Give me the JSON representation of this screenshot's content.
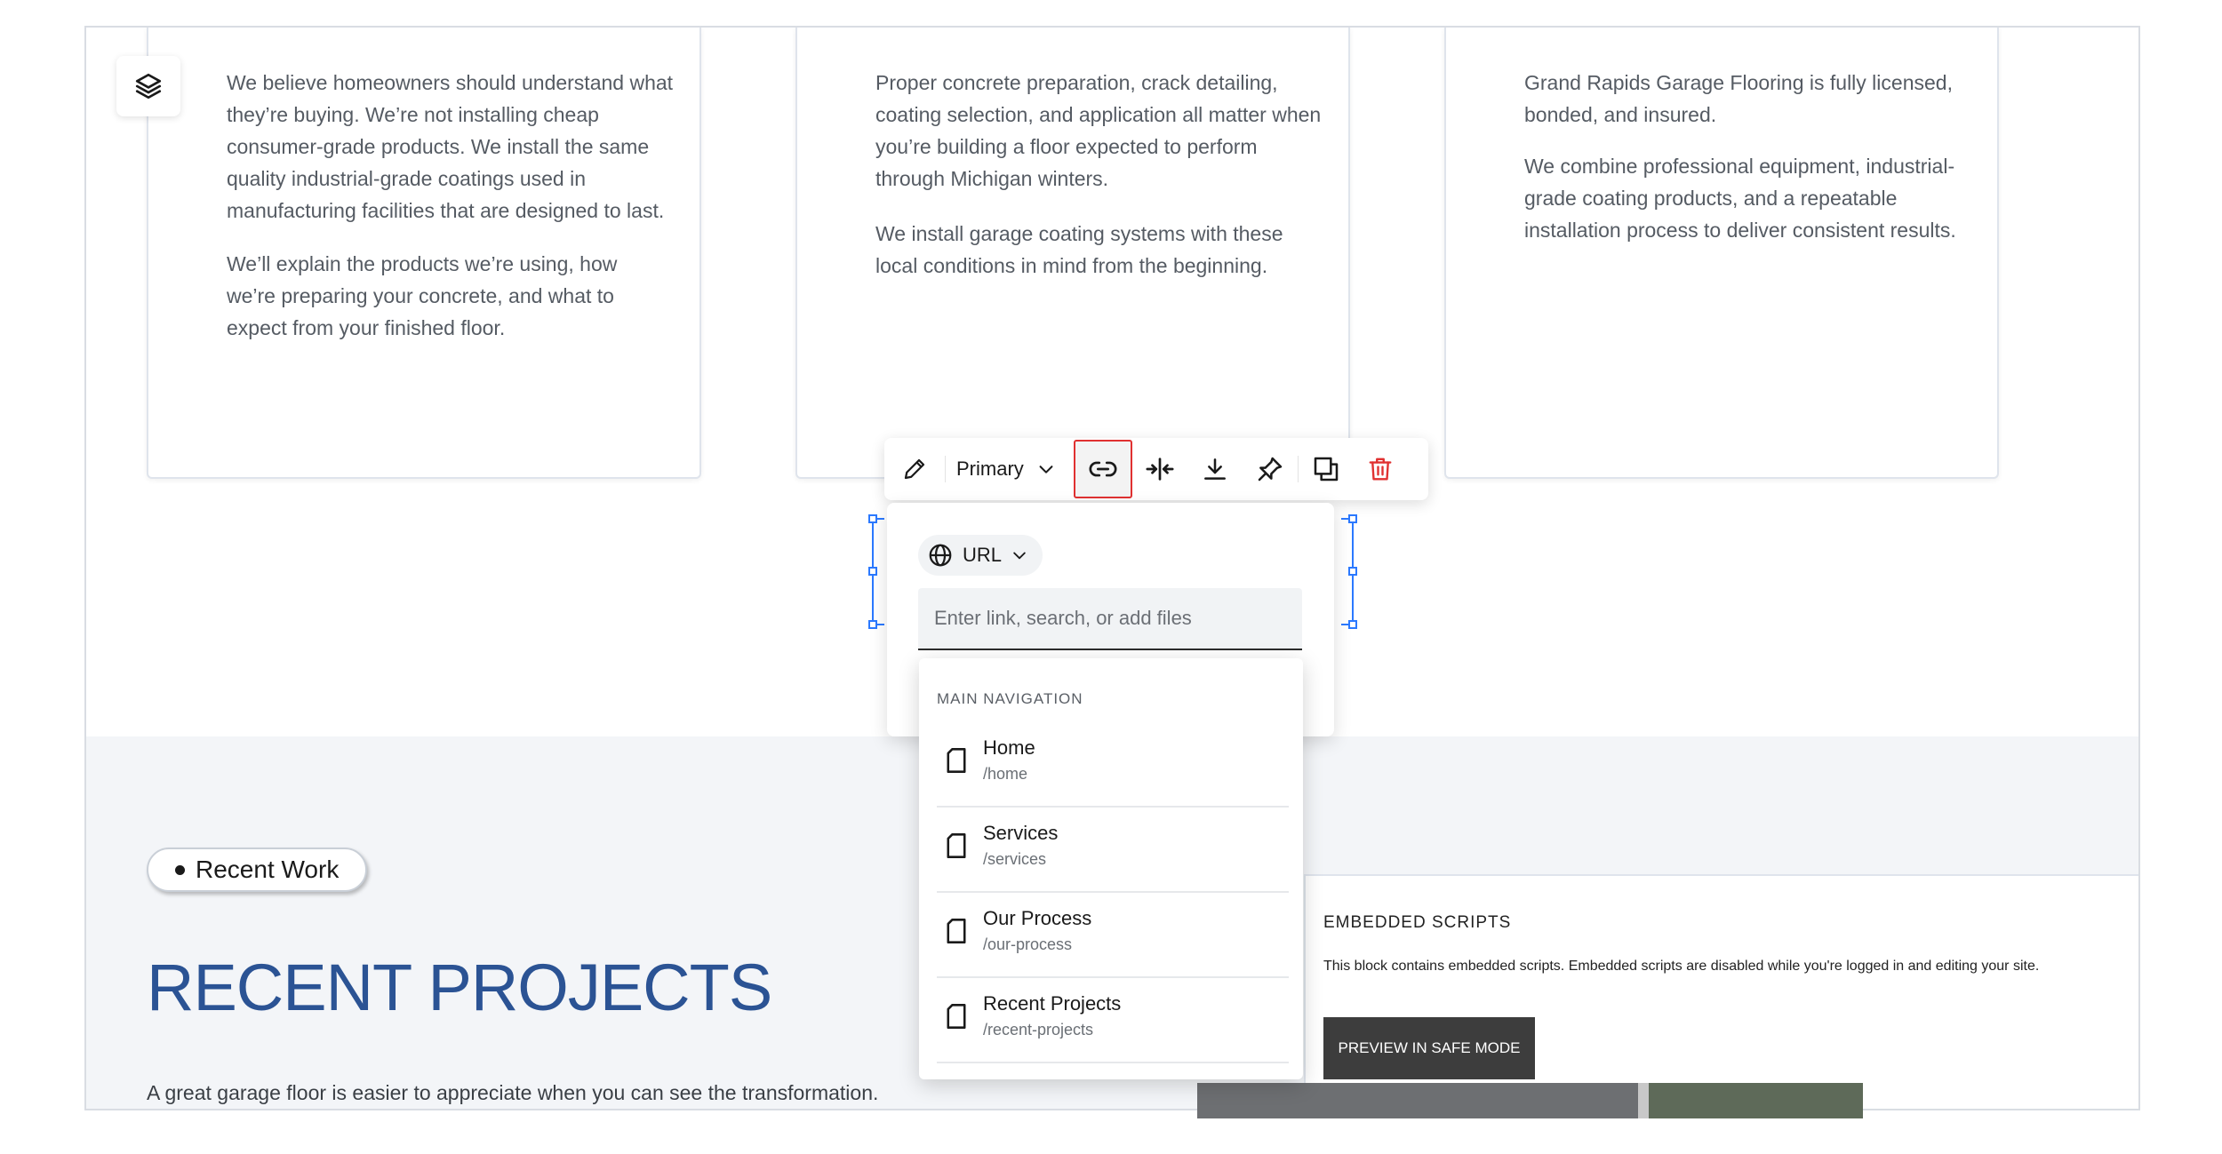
{
  "cards": [
    {
      "paragraphs": [
        "We believe homeowners should understand what they’re buying. We’re not installing cheap consumer-grade products. We install the same quality industrial-grade coatings used in manufacturing facilities that are designed to last.",
        "We’ll explain the products we’re using, how we’re preparing your concrete, and what to expect from your finished floor."
      ]
    },
    {
      "paragraphs": [
        "Proper concrete preparation, crack detailing, coating selection, and application all matter when you’re building a floor expected to perform through Michigan winters.",
        "We install garage coating systems with these local conditions in mind from the beginning."
      ]
    },
    {
      "paragraphs": [
        "Grand Rapids Garage Flooring is fully licensed, bonded, and insured.",
        "We combine professional equipment, industrial-grade coating products, and a repeatable installation process to deliver consistent results."
      ]
    }
  ],
  "toolbar": {
    "style_label": "Primary",
    "icons": [
      "pencil-icon",
      "chevron-down-icon",
      "link-icon",
      "collapse-horizontal-icon",
      "download-icon",
      "pin-icon",
      "duplicate-icon",
      "trash-icon"
    ],
    "delete_color": "#e03131",
    "active_outline_color": "#e03131"
  },
  "link_panel": {
    "type_label": "URL",
    "input_placeholder": "Enter link, search, or add files",
    "input_value": ""
  },
  "nav_dropdown": {
    "heading": "MAIN NAVIGATION",
    "items": [
      {
        "title": "Home",
        "path": "/home"
      },
      {
        "title": "Services",
        "path": "/services"
      },
      {
        "title": "Our Process",
        "path": "/our-process"
      },
      {
        "title": "Recent Projects",
        "path": "/recent-projects"
      }
    ]
  },
  "recent": {
    "pill_label": "Recent Work",
    "title": "RECENT PROJECTS",
    "description": "A great garage floor is easier to appreciate when you can see the transformation.",
    "title_color": "#2b5394"
  },
  "embedded": {
    "heading": "EMBEDDED SCRIPTS",
    "text": "This block contains embedded scripts. Embedded scripts are disabled while you're logged in and editing your site.",
    "button_label": "PREVIEW IN SAFE MODE"
  },
  "selection_color": "#2b79ff"
}
